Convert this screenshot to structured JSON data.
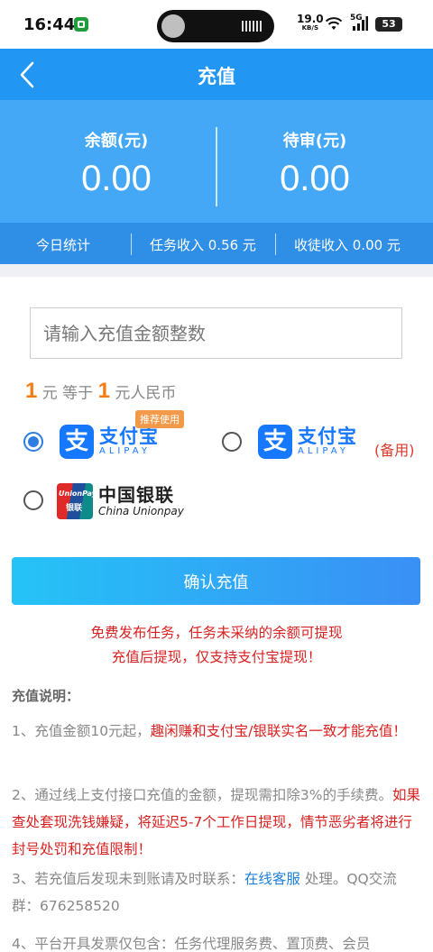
{
  "status_bar": {
    "time": "16:44",
    "speed_value": "19.0",
    "speed_unit": "KB/S",
    "network": "5G",
    "battery": "53"
  },
  "header": {
    "title": "充值",
    "back_icon": "chevron-left-icon"
  },
  "balance": {
    "left_label": "余额(元)",
    "left_value": "0.00",
    "right_label": "待审(元)",
    "right_value": "0.00"
  },
  "stats": {
    "today": "今日统计",
    "task_income": "任务收入 0.56 元",
    "referral_income": "收徒收入 0.00 元"
  },
  "form": {
    "amount_placeholder": "请输入充值金额整数",
    "rate_left_num": "1",
    "rate_mid": "元 等于",
    "rate_right_num": "1",
    "rate_right": "元人民币"
  },
  "payment": {
    "alipay_cn": "支付宝",
    "alipay_en": "ALIPAY",
    "alipay_mark": "支",
    "recommended_badge": "推荐使用",
    "backup_label": "(备用)",
    "unionpay_cn": "中国银联",
    "unionpay_en": "China Unionpay",
    "unionpay_mark_en": "UnionPay",
    "unionpay_mark_cn": "银联",
    "selected": "alipay-primary"
  },
  "confirm_label": "确认充值",
  "notices": [
    "免费发布任务，任务未采纳的余额可提现",
    "充值后提现，仅支持支付宝提现！"
  ],
  "instructions": {
    "title": "充值说明：",
    "item1_prefix": "1、充值金额10元起，",
    "item1_red": "趣闲赚和支付宝/银联实名一致才能充值！",
    "item2_prefix": "2、通过线上支付接口充值的金额，提现需扣除3%的手续费。",
    "item2_red": "如果查处套现洗钱嫌疑，将延迟5-7个工作日提现，情节恶劣者将进行封号处罚和充值限制！",
    "item3_prefix": "3、若充值后发现未到账请及时联系：",
    "item3_link": "在线客服",
    "item3_suffix": " 处理。QQ交流群：676258520",
    "item4": "4、平台开具发票仅包含：任务代理服务费、置顶费、会员"
  },
  "colors": {
    "primary": "#2196f3",
    "accent_orange": "#f57c12",
    "warning_red": "#d92121",
    "alipay_blue": "#1677ff"
  }
}
